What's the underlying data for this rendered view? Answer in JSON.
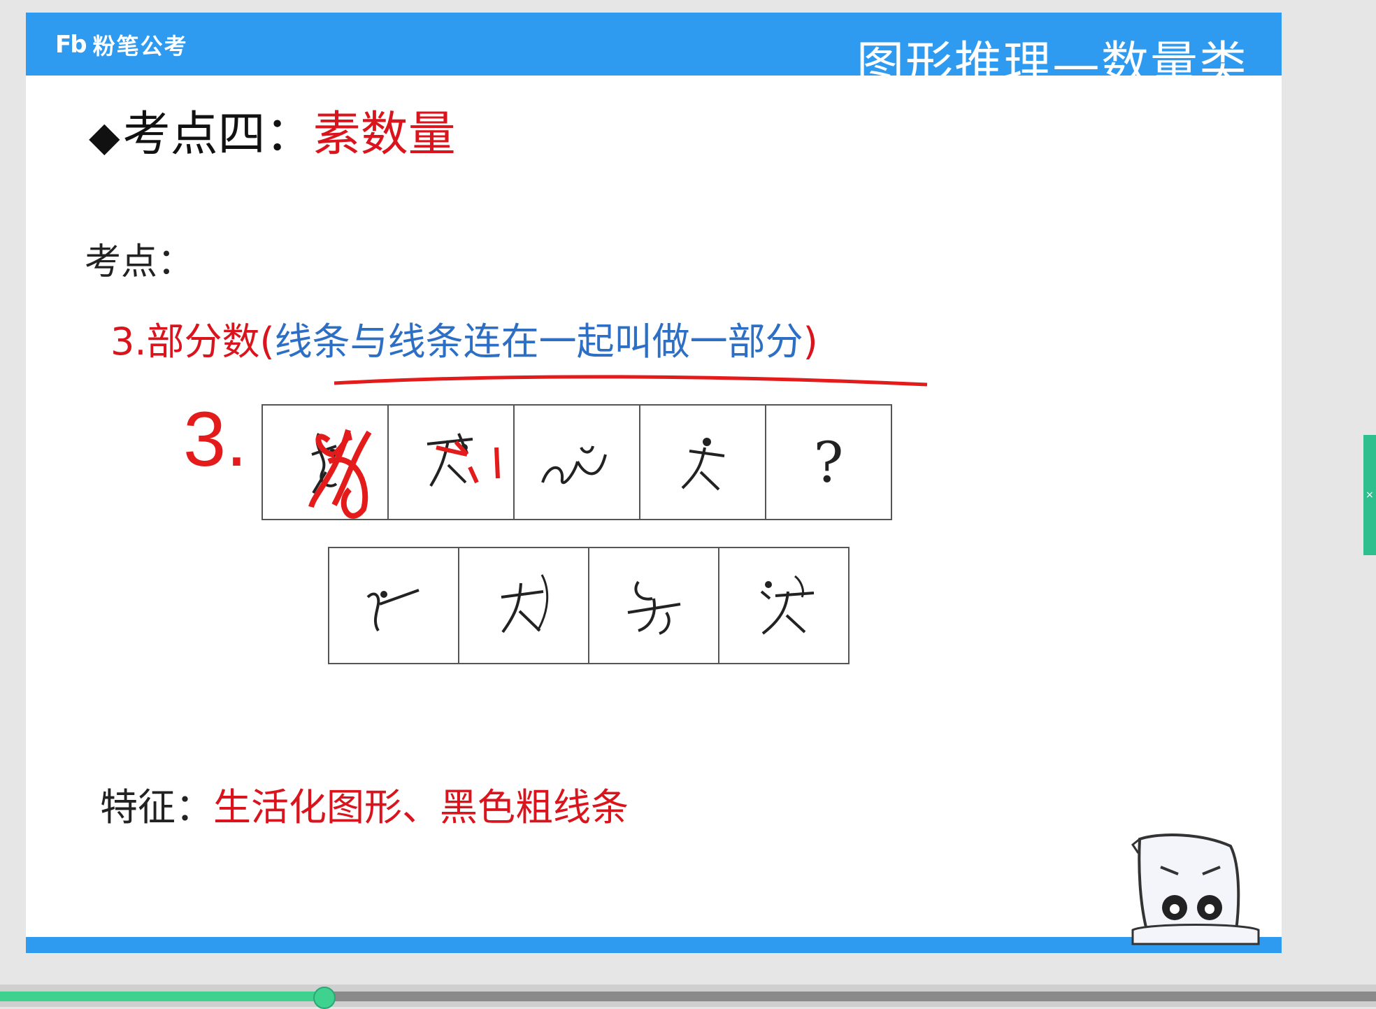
{
  "header": {
    "logo_mark": "Fb",
    "logo_text": "粉笔公考",
    "title": "图形推理—数量类"
  },
  "heading": {
    "bullet": "◆",
    "prefix": "考点四：",
    "emphasis": "素数量"
  },
  "section_label": "考点：",
  "point": {
    "label": "3.部分数(",
    "note": "线条与线条连在一起叫做一部分",
    "close": ")"
  },
  "question": {
    "annotation_number": "3.",
    "unknown_mark": "?"
  },
  "feature": {
    "label": "特征：",
    "value": "生活化图形、黑色粗线条"
  },
  "player": {
    "progress": 0.236
  },
  "colors": {
    "brand_blue": "#2e9bf1",
    "emphasis_red": "#d9141d",
    "note_blue": "#2d6fc4",
    "progress_green": "#3fd28f",
    "side_tab_green": "#2fbf8e"
  },
  "icons": {
    "side_tab": "close-icon",
    "mascot": "mascot-icon"
  }
}
